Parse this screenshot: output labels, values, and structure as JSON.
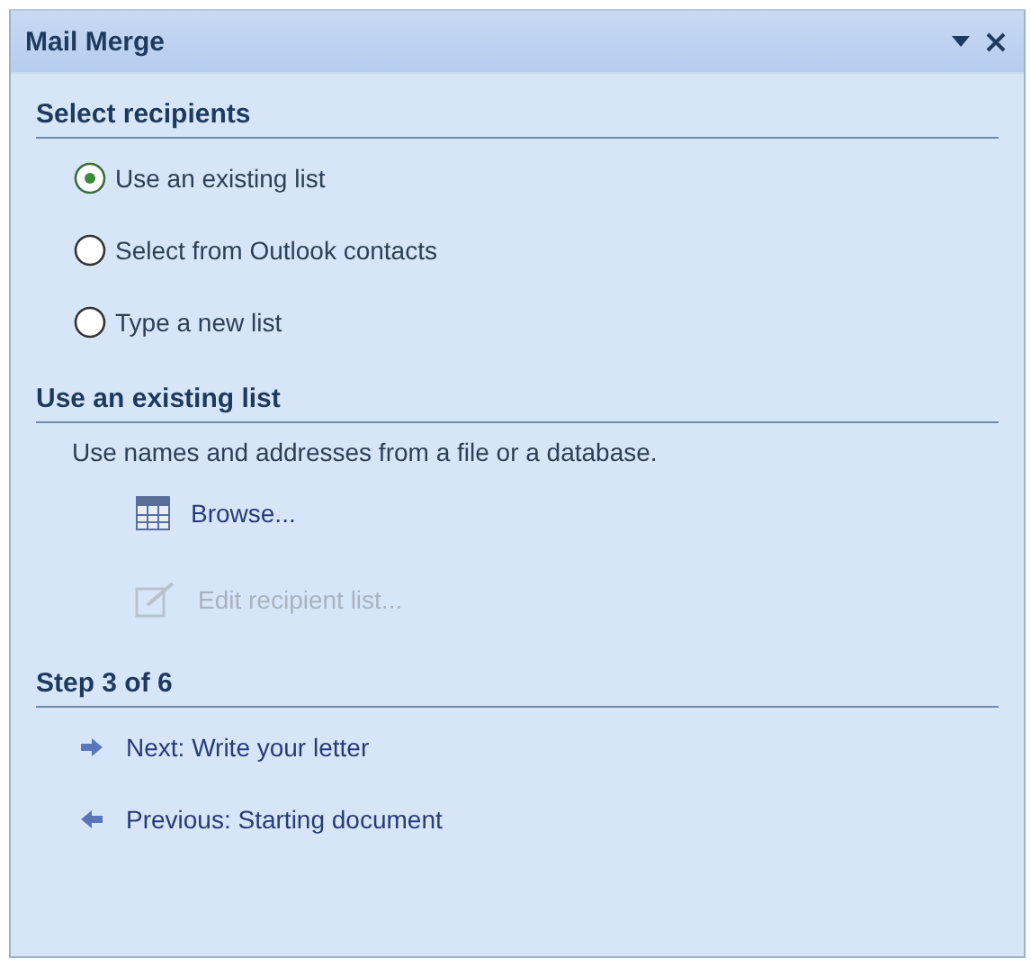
{
  "window": {
    "title": "Mail Merge"
  },
  "select_recipients": {
    "heading": "Select recipients",
    "options": [
      {
        "label": "Use an existing list",
        "selected": true
      },
      {
        "label": "Select from Outlook contacts",
        "selected": false
      },
      {
        "label": "Type a new list",
        "selected": false
      }
    ]
  },
  "existing_list": {
    "heading": "Use an existing list",
    "description": "Use names and addresses from a file or a database.",
    "actions": [
      {
        "kind": "browse",
        "label": "Browse...",
        "disabled": false
      },
      {
        "kind": "edit",
        "label": "Edit recipient list...",
        "disabled": true
      }
    ]
  },
  "step": {
    "heading": "Step 3 of 6",
    "links": [
      {
        "kind": "next",
        "label": "Next: Write your letter"
      },
      {
        "kind": "previous",
        "label": "Previous: Starting document"
      }
    ]
  }
}
